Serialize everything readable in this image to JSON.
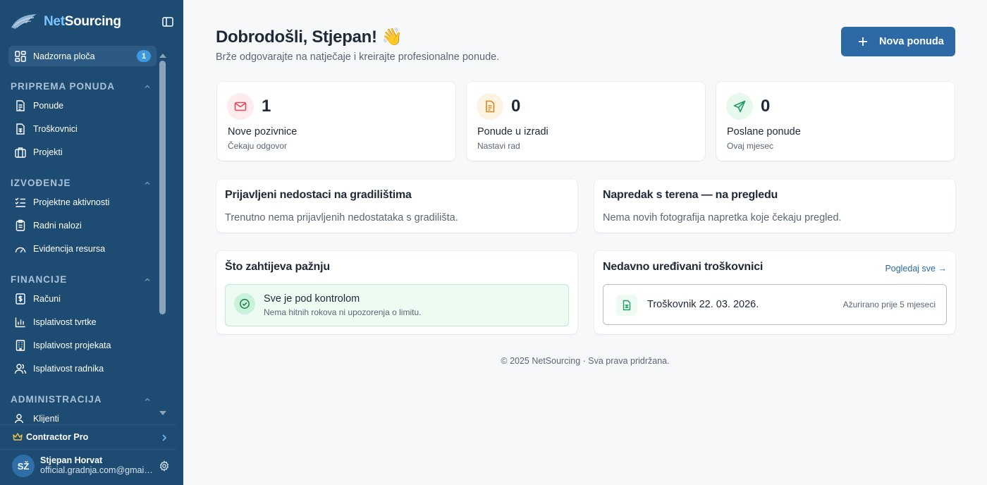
{
  "sidebar": {
    "brand": {
      "name_prefix": "Net",
      "name_suffix": "Sourcing",
      "logo_icon": "wing-logo-icon"
    },
    "active_item": {
      "label": "Nadzorna ploča",
      "badge": "1",
      "icon": "dashboard-icon"
    },
    "sections": [
      {
        "title": "PRIPREMA PONUDA",
        "items": [
          {
            "label": "Ponude",
            "icon": "document-icon"
          },
          {
            "label": "Troškovnici",
            "icon": "spreadsheet-icon"
          },
          {
            "label": "Projekti",
            "icon": "briefcase-icon"
          }
        ]
      },
      {
        "title": "IZVOĐENJE",
        "items": [
          {
            "label": "Projektne aktivnosti",
            "icon": "checklist-icon"
          },
          {
            "label": "Radni nalozi",
            "icon": "clipboard-icon"
          },
          {
            "label": "Evidencija resursa",
            "icon": "gauge-icon"
          }
        ]
      },
      {
        "title": "FINANCIJE",
        "items": [
          {
            "label": "Računi",
            "icon": "invoice-icon"
          },
          {
            "label": "Isplativost tvrtke",
            "icon": "bar-chart-icon"
          },
          {
            "label": "Isplativost projekata",
            "icon": "building-icon"
          },
          {
            "label": "Isplativost radnika",
            "icon": "users-icon"
          }
        ]
      },
      {
        "title": "ADMINISTRACIJA",
        "items": [
          {
            "label": "Klijenti",
            "icon": "users-icon"
          }
        ]
      }
    ],
    "plan": {
      "label": "Contractor Pro",
      "icon": "crown-icon"
    },
    "user": {
      "initials": "SŽ",
      "name": "Stjepan Horvat",
      "email": "official.gradnja.com@gmail.com"
    }
  },
  "header": {
    "title": "Dobrodošli, Stjepan! 👋",
    "subtitle": "Brže odgovarajte na natječaje i kreirajte profesionalne ponude.",
    "primary_button": "Nova ponuda"
  },
  "stats": [
    {
      "value": "1",
      "label": "Nove pozivnice",
      "sub": "Čekaju odgovor",
      "icon": "mail-icon",
      "color": "#e0475a",
      "bg": "#fdecee"
    },
    {
      "value": "0",
      "label": "Ponude u izradi",
      "sub": "Nastavi rad",
      "icon": "document-icon",
      "color": "#d9891a",
      "bg": "#fdf3e3"
    },
    {
      "value": "0",
      "label": "Poslane ponude",
      "sub": "Ovaj mjesec",
      "icon": "send-icon",
      "color": "#1f9d62",
      "bg": "#e7f8ef"
    }
  ],
  "panels": {
    "defects": {
      "title": "Prijavljeni nedostaci na gradilištima",
      "text": "Trenutno nema prijavljenih nedostataka s gradilišta."
    },
    "progress": {
      "title": "Napredak s terena — na pregledu",
      "text": "Nema novih fotografija napretka koje čekaju pregled."
    },
    "attention": {
      "title": "Što zahtijeva pažnju",
      "status_title": "Sve je pod kontrolom",
      "status_sub": "Nema hitnih rokova ni upozorenja o limitu."
    },
    "recent": {
      "title": "Nedavno uređivani troškovnici",
      "link": "Pogledaj sve →",
      "items": [
        {
          "name": "Troškovnik 22. 03. 2026.",
          "updated": "Ažurirano prije 5 mjeseci"
        }
      ]
    }
  },
  "footer": "© 2025 NetSourcing · Sva prava pridržana."
}
